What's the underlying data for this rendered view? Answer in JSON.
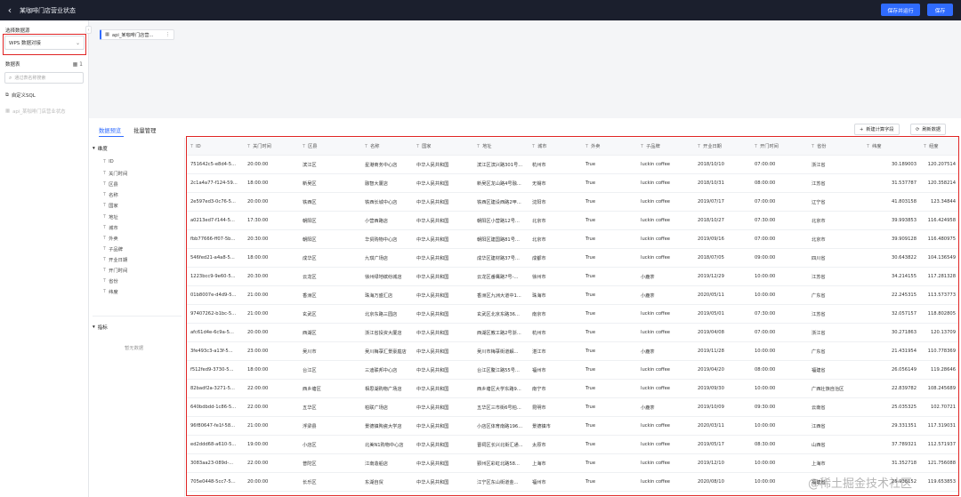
{
  "app": {
    "title": "某咖啡门店营业状态",
    "back_icon": "‹",
    "buttons": {
      "save_run": "保存并运行",
      "save": "保存"
    }
  },
  "sidebar": {
    "datasource_label": "选择数据源",
    "datasource_value": "WPS 数据对接",
    "datatable_label": "数据表",
    "table_count": "1",
    "search_placeholder": "通过表名称搜索",
    "custom_sql": "自定义SQL",
    "table_item": "api_某咖啡门店营业状态"
  },
  "canvas": {
    "node_label": "api_某咖啡门店营...",
    "node_more": "⋮"
  },
  "bottom": {
    "tabs": [
      "数据预览",
      "批量管理"
    ],
    "btn_new_field": "新建计算字段",
    "btn_refresh": "刷新数据"
  },
  "fields": {
    "dim_group": "维度",
    "dim_items": [
      "ID",
      "关门时间",
      "区县",
      "名称",
      "国家",
      "地址",
      "城市",
      "外卖",
      "子品牌",
      "开业日期",
      "开门时间",
      "省份",
      "纬度"
    ],
    "metric_group": "指标",
    "empty_text": "暂无数据"
  },
  "table": {
    "columns": [
      "ID",
      "关门时间",
      "区县",
      "名称",
      "国家",
      "地址",
      "城市",
      "外卖",
      "子品牌",
      "开业日期",
      "开门时间",
      "省份",
      "纬度",
      "经度"
    ],
    "rows": [
      [
        "751642c5-e8d4-5...",
        "20:00:00",
        "滨江区",
        "星港商务中心店",
        "中华人民共和国",
        "滨江区滨兴路301号...",
        "杭州市",
        "True",
        "luckin coffee",
        "2018/10/10",
        "07:00:00",
        "浙江省",
        "30.189003",
        "120.207514"
      ],
      [
        "2c1a4a77-f124-59...",
        "18:00:00",
        "新吴区",
        "融智大厦店",
        "中华人民共和国",
        "新吴区龙山路4号融...",
        "无锡市",
        "True",
        "luckin coffee",
        "2018/10/31",
        "08:00:00",
        "江苏省",
        "31.537787",
        "120.358214"
      ],
      [
        "2e597ed3-0c76-5...",
        "20:00:00",
        "铁西区",
        "铁西长城中心店",
        "中华人民共和国",
        "铁西区建设西路2甲...",
        "沈阳市",
        "True",
        "luckin coffee",
        "2019/07/17",
        "07:00:00",
        "辽宁省",
        "41.803158",
        "123.34844"
      ],
      [
        "a0213ed7-f144-5...",
        "17:30:00",
        "朝阳区",
        "小营西路店",
        "中华人民共和国",
        "朝阳区小营路12号...",
        "北京市",
        "True",
        "luckin coffee",
        "2018/10/27",
        "07:30:00",
        "北京市",
        "39.993853",
        "116.424958"
      ],
      [
        "fbb77666-ff07-5b...",
        "20:30:00",
        "朝阳区",
        "华贸购物中心店",
        "中华人民共和国",
        "朝阳区建国路81号...",
        "北京市",
        "True",
        "luckin coffee",
        "2019/09/16",
        "07:00:00",
        "北京市",
        "39.909128",
        "116.480975"
      ],
      [
        "546fed21-a4a8-5...",
        "18:00:00",
        "成华区",
        "九琪广场店",
        "中华人民共和国",
        "成华区建材路37号...",
        "成都市",
        "True",
        "luckin coffee",
        "2018/07/05",
        "09:00:00",
        "四川省",
        "30.643822",
        "104.136549"
      ],
      [
        "1223bcc9-9e60-5...",
        "20:30:00",
        "云龙区",
        "徐州绿地缤纷城店",
        "中华人民共和国",
        "云龙区番鹰路7号-...",
        "徐州市",
        "True",
        "小鹿茶",
        "2019/12/29",
        "10:00:00",
        "江苏省",
        "34.214155",
        "117.281328"
      ],
      [
        "01b8007e-d4d9-5...",
        "21:00:00",
        "香洲区",
        "珠海万盛汇店",
        "中华人民共和国",
        "香洲区九洲大道中1...",
        "珠海市",
        "True",
        "小鹿茶",
        "2020/05/11",
        "10:00:00",
        "广东省",
        "22.245315",
        "113.573773"
      ],
      [
        "97407262-b1bc-5...",
        "21:00:00",
        "玄武区",
        "北京东路三园店",
        "中华人民共和国",
        "玄武区北京东路36...",
        "南京市",
        "True",
        "luckin coffee",
        "2019/05/01",
        "07:30:00",
        "江苏省",
        "32.057157",
        "118.802805"
      ],
      [
        "afc61d4e-6c9a-5...",
        "20:00:00",
        "西湖区",
        "浙江省投资大厦店",
        "中华人民共和国",
        "西湖区教工路2号浙...",
        "杭州市",
        "True",
        "luckin coffee",
        "2019/04/08",
        "07:00:00",
        "浙江省",
        "30.271863",
        "120.13709"
      ],
      [
        "3fe493c3-a13f-5...",
        "23:00:00",
        "吴川市",
        "吴川梅菉汇景豪庭店",
        "中华人民共和国",
        "吴川市梅菉街道解...",
        "湛江市",
        "True",
        "小鹿茶",
        "2019/11/28",
        "10:00:00",
        "广东省",
        "21.431954",
        "110.778369"
      ],
      [
        "f512fed9-3730-5...",
        "18:00:00",
        "台江区",
        "三迪联邦中心店",
        "中华人民共和国",
        "台江区鳌江路55号...",
        "福州市",
        "True",
        "luckin coffee",
        "2019/04/20",
        "08:00:00",
        "福建省",
        "26.056149",
        "119.28646"
      ],
      [
        "82badf2a-3271-5...",
        "22:00:00",
        "西乡塘区",
        "相思湖购物广场店",
        "中华人民共和国",
        "西乡塘区大学东路9...",
        "南宁市",
        "True",
        "luckin coffee",
        "2019/09/30",
        "10:00:00",
        "广西壮族自治区",
        "22.839782",
        "108.245689"
      ],
      [
        "640bdbdd-1c86-5...",
        "22:00:00",
        "五华区",
        "柏联广场店",
        "中华人民共和国",
        "五华区三市街6号柏...",
        "昆明市",
        "True",
        "小鹿茶",
        "2019/10/09",
        "09:30:00",
        "云南省",
        "25.035325",
        "102.70721"
      ],
      [
        "96f80647-fe1f-58...",
        "21:00:00",
        "浮梁县",
        "景德镇陶瓷大学店",
        "中华人民共和国",
        "小店区体育南路196...",
        "景德镇市",
        "True",
        "luckin coffee",
        "2020/03/11",
        "10:00:00",
        "江西省",
        "29.331351",
        "117.319031"
      ],
      [
        "ed2ddd68-a610-5...",
        "19:00:00",
        "小店区",
        "北美N1购物中心店",
        "中华人民共和国",
        "晋祠区长兴北街汇通...",
        "太原市",
        "True",
        "luckin coffee",
        "2019/05/17",
        "08:30:00",
        "山西省",
        "37.789321",
        "112.571937"
      ],
      [
        "3083aa23-089d-...",
        "22:00:00",
        "普陀区",
        "江南造船店",
        "中华人民共和国",
        "鄞州区彩虹北路58...",
        "上海市",
        "True",
        "luckin coffee",
        "2019/12/10",
        "10:00:00",
        "上海市",
        "31.352718",
        "121.756088"
      ],
      [
        "705e0448-5cc7-5...",
        "20:00:00",
        "长乐区",
        "东湖自贸",
        "中华人民共和国",
        "江宁区东山街道金...",
        "福州市",
        "True",
        "luckin coffee",
        "2020/08/10",
        "10:00:00",
        "福建省",
        "25.938152",
        "119.653853"
      ]
    ]
  },
  "watermark": "@稀土掘金技术社区"
}
